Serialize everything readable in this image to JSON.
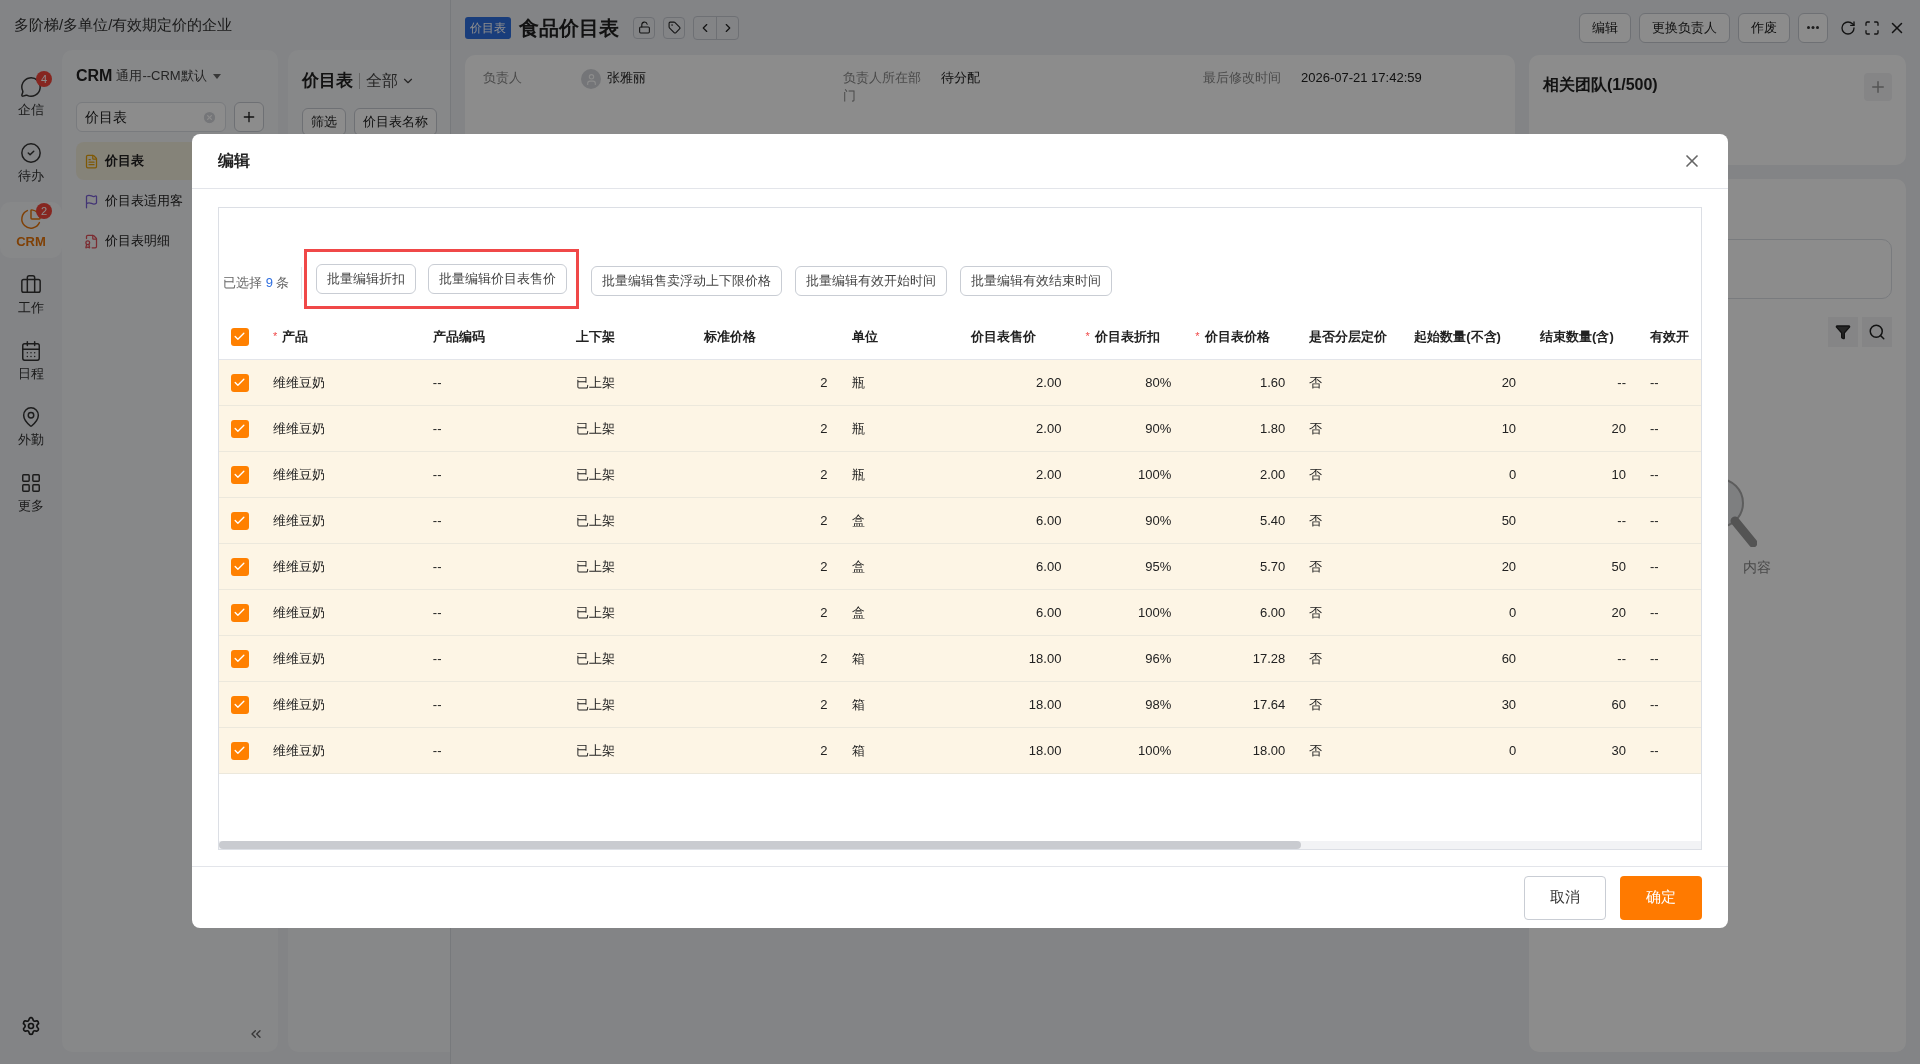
{
  "breadcrumb": "多阶梯/多单位/有效期定价的企业",
  "rail": [
    {
      "label": "企信",
      "badge": "4",
      "selected": false
    },
    {
      "label": "待办",
      "selected": false
    },
    {
      "label": "CRM",
      "badge": "2",
      "selected": true
    },
    {
      "label": "工作",
      "selected": false
    },
    {
      "label": "日程",
      "selected": false
    },
    {
      "label": "外勤",
      "selected": false
    },
    {
      "label": "更多",
      "selected": false
    }
  ],
  "nav": {
    "module": "CRM",
    "view": "通用--CRM默认",
    "search": "价目表",
    "items": [
      {
        "label": "价目表",
        "selected": true
      },
      {
        "label": "价目表适用客",
        "selected": false
      },
      {
        "label": "价目表明细",
        "selected": false
      }
    ]
  },
  "list": {
    "title": "价目表",
    "scope": "全部",
    "buttons": [
      "筛选",
      "价目表名称"
    ]
  },
  "record": {
    "badge": "价目表",
    "title": "食品价目表",
    "actions": [
      "编辑",
      "更换负责人",
      "作废"
    ],
    "fields": [
      {
        "label": "负责人",
        "value": "张雅丽",
        "kind": "user"
      },
      {
        "label": "负责人所在部门",
        "value": "待分配",
        "kind": "text"
      },
      {
        "label": "最后修改时间",
        "value": "2026-07-21 17:42:59",
        "kind": "text"
      }
    ]
  },
  "team": {
    "title": "相关团队(1/500)",
    "empty_hint": "内容"
  },
  "dialog": {
    "title": "编辑",
    "selected_prefix": "已选择",
    "selected_count": "9",
    "selected_suffix": "条",
    "bulk_actions": [
      {
        "label": "批量编辑折扣",
        "highlighted": true
      },
      {
        "label": "批量编辑价目表售价",
        "highlighted": true
      },
      {
        "label": "批量编辑售卖浮动上下限价格",
        "highlighted": false
      },
      {
        "label": "批量编辑有效开始时间",
        "highlighted": false
      },
      {
        "label": "批量编辑有效结束时间",
        "highlighted": false
      }
    ],
    "all_checked": true,
    "required_mark": "*",
    "columns": [
      {
        "label": "产品",
        "required": true
      },
      {
        "label": "产品编码",
        "required": false
      },
      {
        "label": "上下架",
        "required": false
      },
      {
        "label": "标准价格",
        "required": false
      },
      {
        "label": "单位",
        "required": false
      },
      {
        "label": "价目表售价",
        "required": false
      },
      {
        "label": "价目表折扣",
        "required": true
      },
      {
        "label": "价目表价格",
        "required": true
      },
      {
        "label": "是否分层定价",
        "required": false
      },
      {
        "label": "起始数量(不含)",
        "required": false
      },
      {
        "label": "结束数量(含)",
        "required": false
      },
      {
        "label": "有效开",
        "required": false
      }
    ],
    "rows": [
      {
        "checked": true,
        "cells": [
          "维维豆奶",
          "--",
          "已上架",
          "2",
          "瓶",
          "2.00",
          "80%",
          "1.60",
          "否",
          "20",
          "--",
          "--"
        ]
      },
      {
        "checked": true,
        "cells": [
          "维维豆奶",
          "--",
          "已上架",
          "2",
          "瓶",
          "2.00",
          "90%",
          "1.80",
          "否",
          "10",
          "20",
          "--"
        ]
      },
      {
        "checked": true,
        "cells": [
          "维维豆奶",
          "--",
          "已上架",
          "2",
          "瓶",
          "2.00",
          "100%",
          "2.00",
          "否",
          "0",
          "10",
          "--"
        ]
      },
      {
        "checked": true,
        "cells": [
          "维维豆奶",
          "--",
          "已上架",
          "2",
          "盒",
          "6.00",
          "90%",
          "5.40",
          "否",
          "50",
          "--",
          "--"
        ]
      },
      {
        "checked": true,
        "cells": [
          "维维豆奶",
          "--",
          "已上架",
          "2",
          "盒",
          "6.00",
          "95%",
          "5.70",
          "否",
          "20",
          "50",
          "--"
        ]
      },
      {
        "checked": true,
        "cells": [
          "维维豆奶",
          "--",
          "已上架",
          "2",
          "盒",
          "6.00",
          "100%",
          "6.00",
          "否",
          "0",
          "20",
          "--"
        ]
      },
      {
        "checked": true,
        "cells": [
          "维维豆奶",
          "--",
          "已上架",
          "2",
          "箱",
          "18.00",
          "96%",
          "17.28",
          "否",
          "60",
          "--",
          "--"
        ]
      },
      {
        "checked": true,
        "cells": [
          "维维豆奶",
          "--",
          "已上架",
          "2",
          "箱",
          "18.00",
          "98%",
          "17.64",
          "否",
          "30",
          "60",
          "--"
        ]
      },
      {
        "checked": true,
        "cells": [
          "维维豆奶",
          "--",
          "已上架",
          "2",
          "箱",
          "18.00",
          "100%",
          "18.00",
          "否",
          "0",
          "30",
          "--"
        ]
      }
    ],
    "buttons": [
      "取消",
      "确定"
    ]
  }
}
